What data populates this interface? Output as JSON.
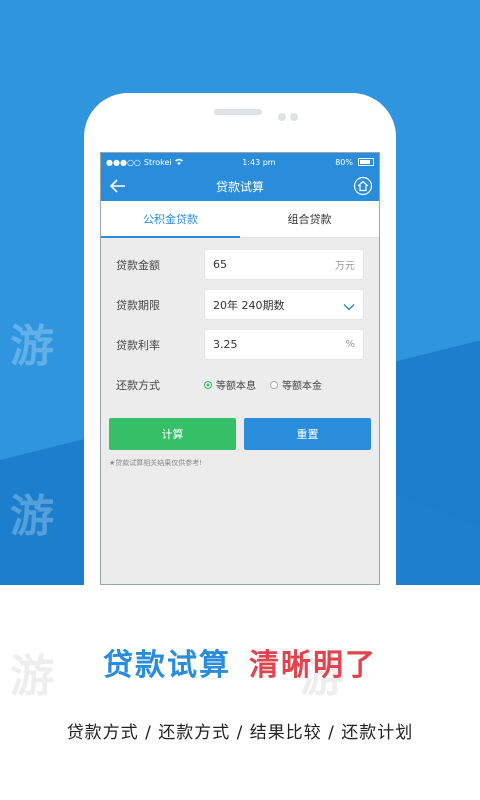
{
  "status": {
    "carrier": "Strokei",
    "time": "1:43 pm",
    "battery": "80%"
  },
  "nav": {
    "title": "贷款试算"
  },
  "tabs": [
    {
      "label": "公积金贷款"
    },
    {
      "label": "组合贷款"
    }
  ],
  "form": {
    "amount_label": "贷款金额",
    "amount_value": "65",
    "amount_unit": "万元",
    "term_label": "贷款期限",
    "term_value": "20年 240期数",
    "rate_label": "贷款利率",
    "rate_value": "3.25",
    "rate_unit": "%",
    "method_label": "还款方式",
    "method_option1": "等额本息",
    "method_option2": "等额本金",
    "method_selected": "等额本息"
  },
  "buttons": {
    "calc": "计算",
    "reset": "重置"
  },
  "note": "★贷款试算相关结果仅供参考!",
  "headline": {
    "part1": "贷款试算",
    "part2": "清晰明了"
  },
  "subline": "贷款方式 / 还款方式 / 结果比较 / 还款计划",
  "watermark": "游",
  "colors": {
    "brand_blue": "#2a8ddb",
    "calc_green": "#35bf67",
    "headline_red": "#e0444e"
  }
}
